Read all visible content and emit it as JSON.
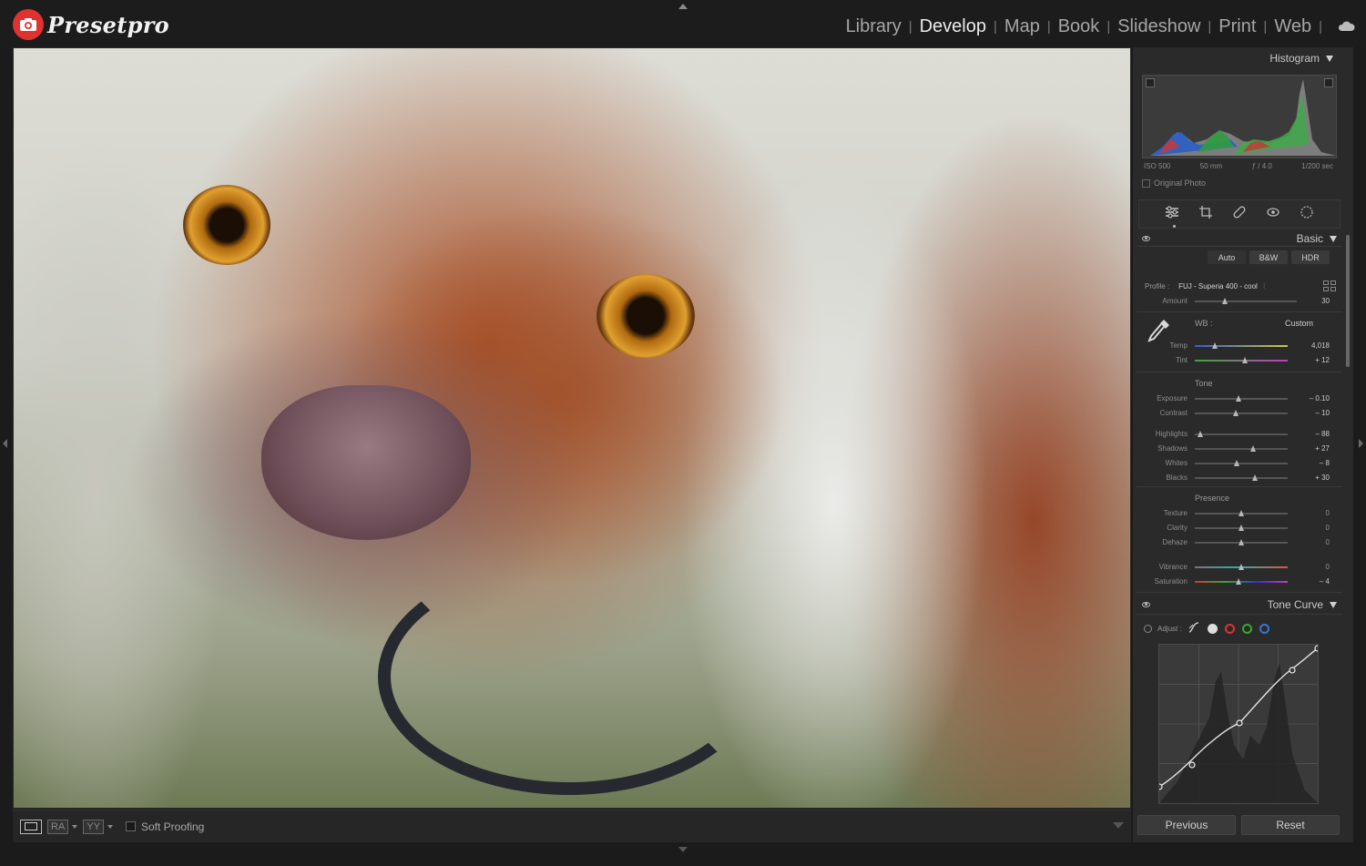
{
  "app": {
    "brand": "Presetpro"
  },
  "modules": [
    "Library",
    "Develop",
    "Map",
    "Book",
    "Slideshow",
    "Print",
    "Web"
  ],
  "active_module": "Develop",
  "toolbar": {
    "view_btn_2": "RA",
    "view_btn_3": "YY",
    "soft_proofing": "Soft Proofing"
  },
  "histogram": {
    "title": "Histogram",
    "iso": "ISO 500",
    "focal": "50 mm",
    "aperture": "ƒ / 4.0",
    "shutter": "1/200 sec",
    "original_photo": "Original Photo"
  },
  "basic": {
    "title": "Basic",
    "treatment": [
      "Auto",
      "B&W",
      "HDR"
    ],
    "profile_label": "Profile :",
    "profile_value": "FUJ - Superia 400 - cool",
    "amount_label": "Amount",
    "amount_value": "30",
    "amount_level": 0.3,
    "wb_label": "WB :",
    "wb_value": "Custom",
    "tone_label": "Tone",
    "presence_label": "Presence",
    "sliders_wb": [
      {
        "label": "Temp",
        "value": "4,018",
        "level": 0.22
      },
      {
        "label": "Tint",
        "value": "+ 12",
        "level": 0.54
      }
    ],
    "sliders_tone": [
      {
        "label": "Exposure",
        "value": "– 0.10",
        "level": 0.48
      },
      {
        "label": "Contrast",
        "value": "– 10",
        "level": 0.45
      }
    ],
    "sliders_tone2": [
      {
        "label": "Highlights",
        "value": "– 88",
        "level": 0.06
      },
      {
        "label": "Shadows",
        "value": "+ 27",
        "level": 0.63
      },
      {
        "label": "Whites",
        "value": "– 8",
        "level": 0.46
      },
      {
        "label": "Blacks",
        "value": "+ 30",
        "level": 0.65
      }
    ],
    "sliders_presence": [
      {
        "label": "Texture",
        "value": "0",
        "level": 0.5
      },
      {
        "label": "Clarity",
        "value": "0",
        "level": 0.5
      },
      {
        "label": "Dehaze",
        "value": "0",
        "level": 0.5
      }
    ],
    "sliders_color": [
      {
        "label": "Vibrance",
        "value": "0",
        "level": 0.5
      },
      {
        "label": "Saturation",
        "value": "– 4",
        "level": 0.48
      }
    ]
  },
  "tone_curve": {
    "title": "Tone Curve",
    "adjust_label": "Adjust :"
  },
  "buttons": {
    "previous": "Previous",
    "reset": "Reset"
  },
  "colors": {
    "brand_red": "#e0322f",
    "panel_bg": "#2a2a2a"
  }
}
